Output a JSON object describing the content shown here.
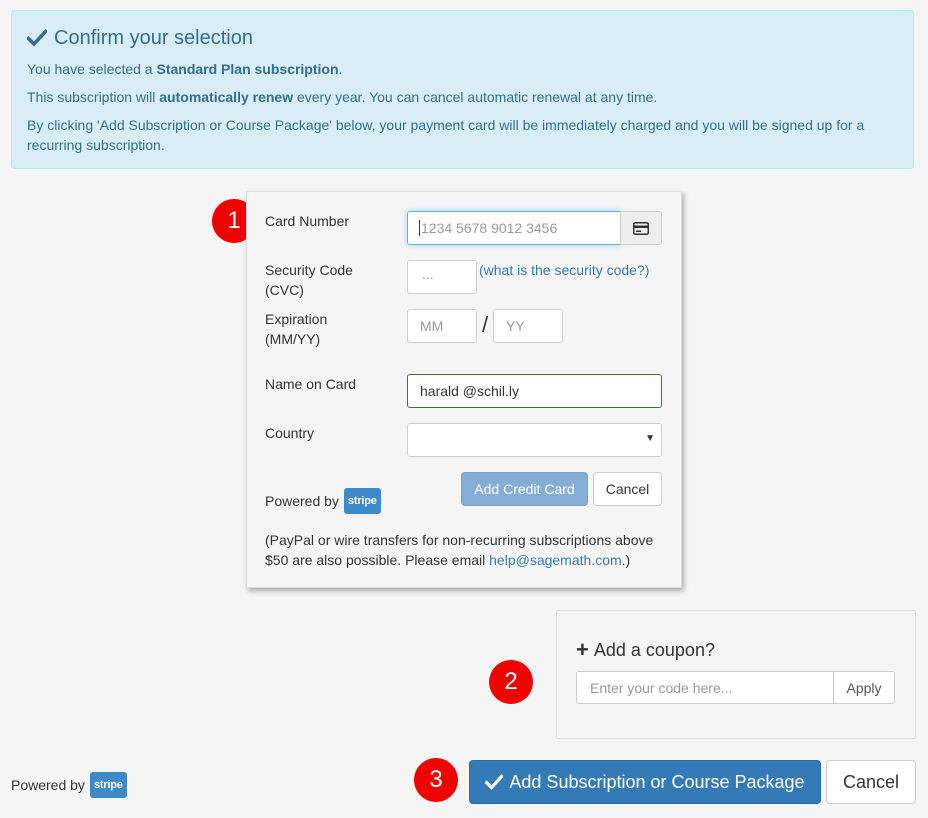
{
  "confirm": {
    "title": "Confirm your selection",
    "line1_pre": "You have selected a ",
    "line1_bold": "Standard Plan subscription",
    "line1_post": ".",
    "line2_pre": "This subscription will ",
    "line2_bold": "automatically renew",
    "line2_post": " every year. You can cancel automatic renewal at any time.",
    "line3": "By clicking 'Add Subscription or Course Package' below, your payment card will be immediately charged and you will be signed up for a recurring subscription."
  },
  "card_form": {
    "card_number_label": "Card Number",
    "card_number_placeholder": "1234 5678 9012 3456",
    "security_label_1": "Security Code",
    "security_label_2": "(CVC)",
    "cvc_placeholder": "...",
    "cvc_help_link": "(what is the security code?)",
    "expiration_label_1": "Expiration",
    "expiration_label_2": "(MM/YY)",
    "month_placeholder": "MM",
    "slash": "/",
    "year_placeholder": "YY",
    "name_label": "Name on Card",
    "name_value": "harald @schil.ly",
    "country_label": "Country",
    "country_value": "",
    "add_card_button": "Add Credit Card",
    "cancel_button": "Cancel",
    "powered_by": "Powered by",
    "stripe": "stripe",
    "note_pre": "(PayPal or wire transfers for non-recurring subscriptions above $50 are also possible. Please email ",
    "note_email": "help@sagemath.com",
    "note_post": ".)"
  },
  "coupon": {
    "title": "Add a coupon?",
    "placeholder": "Enter your code here...",
    "apply_button": "Apply"
  },
  "footer": {
    "powered_by": "Powered by",
    "stripe": "stripe",
    "submit_button": "Add Subscription or Course Package",
    "cancel_button": "Cancel"
  },
  "markers": [
    "1",
    "2",
    "3"
  ],
  "colors": {
    "alert_bg": "#d9edf7",
    "alert_text": "#31708f",
    "primary": "#337ab7",
    "marker": "#f00000",
    "stripe": "#3e8ac8"
  }
}
